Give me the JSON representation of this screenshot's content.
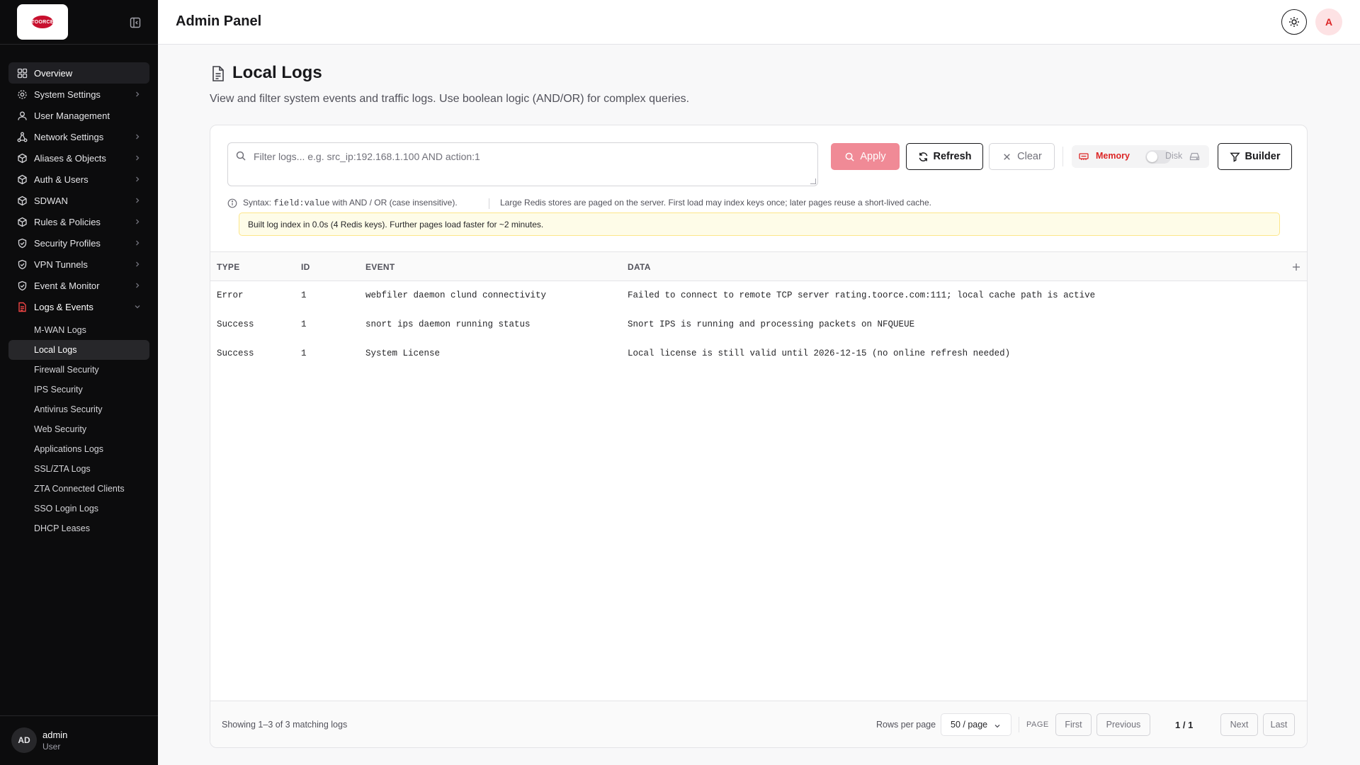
{
  "brand": {
    "logo_text": "TOORCE",
    "accent": "#dc2626"
  },
  "sidebar": {
    "items": [
      {
        "label": "Overview",
        "icon": "layout-grid-icon",
        "active": true
      },
      {
        "label": "System Settings",
        "icon": "gear-icon"
      },
      {
        "label": "User Management",
        "icon": "user-icon"
      },
      {
        "label": "Network Settings",
        "icon": "network-icon"
      },
      {
        "label": "Aliases & Objects",
        "icon": "cube-icon"
      },
      {
        "label": "Auth & Users",
        "icon": "cube-icon"
      },
      {
        "label": "SDWAN",
        "icon": "cube-icon"
      },
      {
        "label": "Rules & Policies",
        "icon": "cube-icon"
      },
      {
        "label": "Security Profiles",
        "icon": "shield-icon"
      },
      {
        "label": "VPN Tunnels",
        "icon": "shield-icon"
      },
      {
        "label": "Event & Monitor",
        "icon": "shield-icon"
      },
      {
        "label": "Logs & Events",
        "icon": "file-text-icon",
        "expanded": true
      }
    ],
    "sub_items": [
      {
        "label": "M-WAN Logs"
      },
      {
        "label": "Local Logs",
        "active": true
      },
      {
        "label": "Firewall Security"
      },
      {
        "label": "IPS Security"
      },
      {
        "label": "Antivirus Security"
      },
      {
        "label": "Web Security"
      },
      {
        "label": "Applications Logs"
      },
      {
        "label": "SSL/ZTA Logs"
      },
      {
        "label": "ZTA Connected Clients"
      },
      {
        "label": "SSO Login Logs"
      },
      {
        "label": "DHCP Leases"
      }
    ],
    "user": {
      "initials": "AD",
      "name": "admin",
      "role": "User"
    }
  },
  "header": {
    "title": "Admin Panel",
    "avatar_initial": "A"
  },
  "page": {
    "title": "Local Logs",
    "description": "View and filter system events and traffic logs. Use boolean logic (AND/OR) for complex queries."
  },
  "filter": {
    "placeholder": "Filter logs... e.g. src_ip:192.168.1.100 AND action:1",
    "value": "",
    "apply_label": "Apply",
    "refresh_label": "Refresh",
    "clear_label": "Clear",
    "builder_label": "Builder",
    "memory_label": "Memory",
    "disk_label": "Disk",
    "syntax_prefix": "Syntax:",
    "syntax_code": "field:value",
    "syntax_with": "with",
    "syntax_ops": "AND / OR",
    "syntax_suffix": "(case insensitive).",
    "redis_note": "Large Redis stores are paged on the server. First load may index keys once; later pages reuse a short-lived cache.",
    "notice": "Built log index in 0.0s (4 Redis keys). Further pages load faster for ~2 minutes."
  },
  "table": {
    "columns": [
      "TYPE",
      "ID",
      "EVENT",
      "DATA"
    ],
    "rows": [
      {
        "type": "Error",
        "id": "1",
        "event": "webfiler daemon clund connectivity",
        "data": "Failed to connect to remote TCP server rating.toorce.com:111; local cache path is active"
      },
      {
        "type": "Success",
        "id": "1",
        "event": "snort ips daemon running status",
        "data": "Snort IPS is running and processing packets on NFQUEUE"
      },
      {
        "type": "Success",
        "id": "1",
        "event": "System License",
        "data": "Local license is still valid until 2026-12-15 (no online refresh needed)"
      }
    ]
  },
  "pagination": {
    "showing": "Showing 1–3 of 3 matching logs",
    "rows_per_page_label": "Rows per page",
    "rows_per_page_value": "50 / page",
    "page_label": "PAGE",
    "first": "First",
    "previous": "Previous",
    "page_count": "1 / 1",
    "next": "Next",
    "last": "Last"
  }
}
